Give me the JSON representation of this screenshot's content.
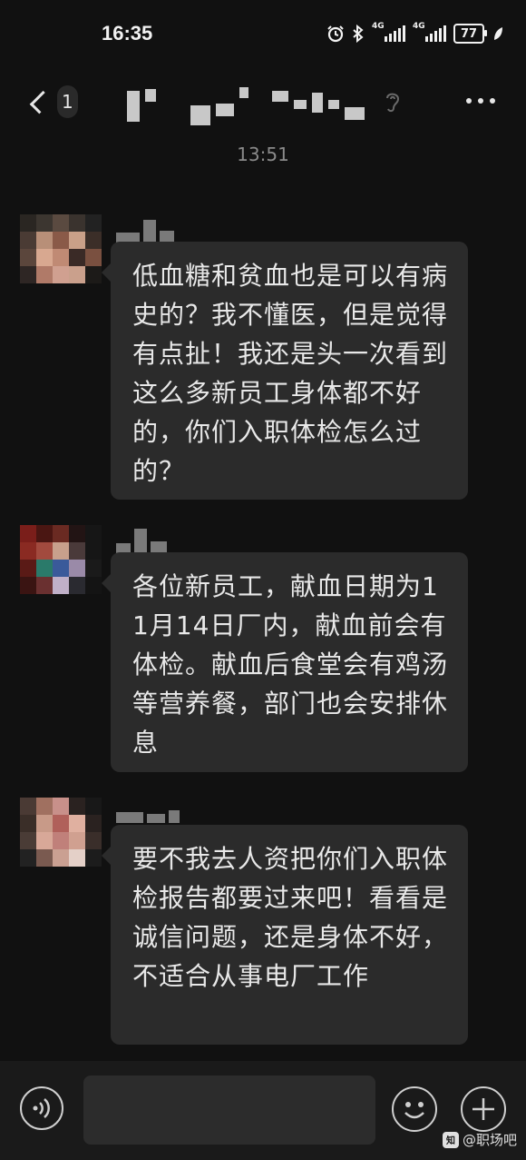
{
  "status_bar": {
    "time": "16:35",
    "network_1": "4G",
    "network_2": "4G",
    "battery": "77",
    "icons": [
      "alarm-icon",
      "bluetooth-icon",
      "signal-icon",
      "battery-icon",
      "leaf-icon"
    ]
  },
  "header": {
    "unread_count": "1",
    "icons": [
      "back-chevron-icon",
      "ear-icon",
      "more-icon"
    ]
  },
  "chat": {
    "timestamp": "13:51",
    "messages": [
      {
        "text": "低血糖和贫血也是可以有病史的？我不懂医，但是觉得有点扯！我还是头一次看到这么多新员工身体都不好的，你们入职体检怎么过的？"
      },
      {
        "text": "各位新员工，献血日期为11月14日厂内，献血前会有体检。献血后食堂会有鸡汤等营养餐，部门也会安排休息"
      },
      {
        "text": "要不我去人资把你们入职体检报告都要过来吧！看看是诚信问题，还是身体不好，不适合从事电厂工作"
      }
    ]
  },
  "input_bar": {
    "icons": [
      "voice-icon",
      "emoji-icon",
      "plus-icon"
    ]
  },
  "watermark": {
    "logo": "知",
    "text": "@职场吧"
  }
}
